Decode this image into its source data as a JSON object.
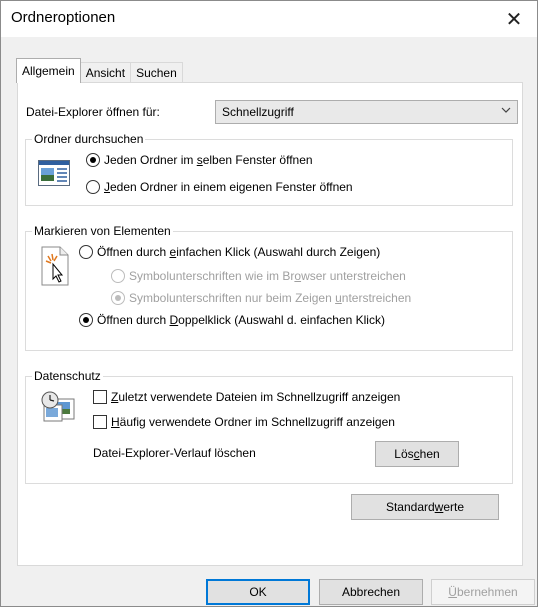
{
  "window": {
    "title": "Ordneroptionen",
    "close_glyph": "✕"
  },
  "tabs": [
    {
      "label": "Allgemein",
      "active": true
    },
    {
      "label": "Ansicht",
      "active": false
    },
    {
      "label": "Suchen",
      "active": false
    }
  ],
  "explorer_open": {
    "label": "Datei-Explorer öffnen für:",
    "selected": "Schnellzugriff"
  },
  "browse_folders": {
    "legend": "Ordner durchsuchen",
    "options": [
      {
        "pre": "Jeden Ordner im ",
        "key": "s",
        "post": "elben Fenster öffnen",
        "checked": true
      },
      {
        "pre": "",
        "key": "J",
        "post": "eden Ordner in einem eigenen Fenster öffnen",
        "checked": false
      }
    ]
  },
  "click_items": {
    "legend": "Markieren von Elementen",
    "single_click": {
      "pre": "Öffnen durch ",
      "key": "e",
      "post": "infachen Klick (Auswahl durch Zeigen)",
      "checked": false
    },
    "underline_browser": {
      "pre": "Symbolunterschriften wie im Br",
      "key": "o",
      "post": "wser unterstreichen",
      "checked": false,
      "disabled": true
    },
    "underline_point": {
      "pre": "Symbolunterschriften nur beim Zeigen ",
      "key": "u",
      "post": "nterstreichen",
      "checked": true,
      "disabled": true
    },
    "double_click": {
      "pre": "Öffnen durch ",
      "key": "D",
      "post": "oppelklick (Auswahl d. einfachen Klick)",
      "checked": true
    }
  },
  "privacy": {
    "legend": "Datenschutz",
    "recent_files": {
      "pre": "",
      "key": "Z",
      "post": "uletzt verwendete Dateien im Schnellzugriff anzeigen",
      "checked": false
    },
    "frequent_folders": {
      "pre": "",
      "key": "H",
      "post": "äufig verwendete Ordner im Schnellzugriff anzeigen",
      "checked": false
    },
    "history_label": "Datei-Explorer-Verlauf löschen",
    "clear_button": {
      "pre": "Lös",
      "key": "c",
      "post": "hen"
    }
  },
  "defaults_button": {
    "pre": "Standard",
    "key": "w",
    "post": "erte"
  },
  "footer": {
    "ok": "OK",
    "cancel": "Abbrechen",
    "apply": {
      "pre": "",
      "key": "Ü",
      "post": "bernehmen"
    }
  },
  "colors": {
    "accent": "#0078d7",
    "dialog_bg": "#f0f0f0",
    "panel_bg": "#ffffff",
    "disabled_text": "#a0a0a0"
  },
  "icons": [
    "close-icon",
    "chevron-down-icon",
    "folder-window-icon",
    "pointer-click-icon",
    "privacy-clock-icon"
  ]
}
